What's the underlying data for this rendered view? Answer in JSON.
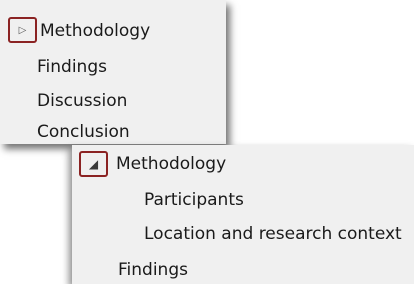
{
  "collapsed_outline": {
    "toggle_icon": "triangle-right-outline-icon",
    "items": [
      "Methodology",
      "Findings",
      "Discussion",
      "Conclusion"
    ]
  },
  "expanded_outline": {
    "toggle_icon": "triangle-down-filled-icon",
    "heading": "Methodology",
    "children": [
      "Participants",
      "Location and research context"
    ],
    "next": "Findings"
  },
  "highlight_color": "#8b2323",
  "panel_color": "#f0f0f0"
}
